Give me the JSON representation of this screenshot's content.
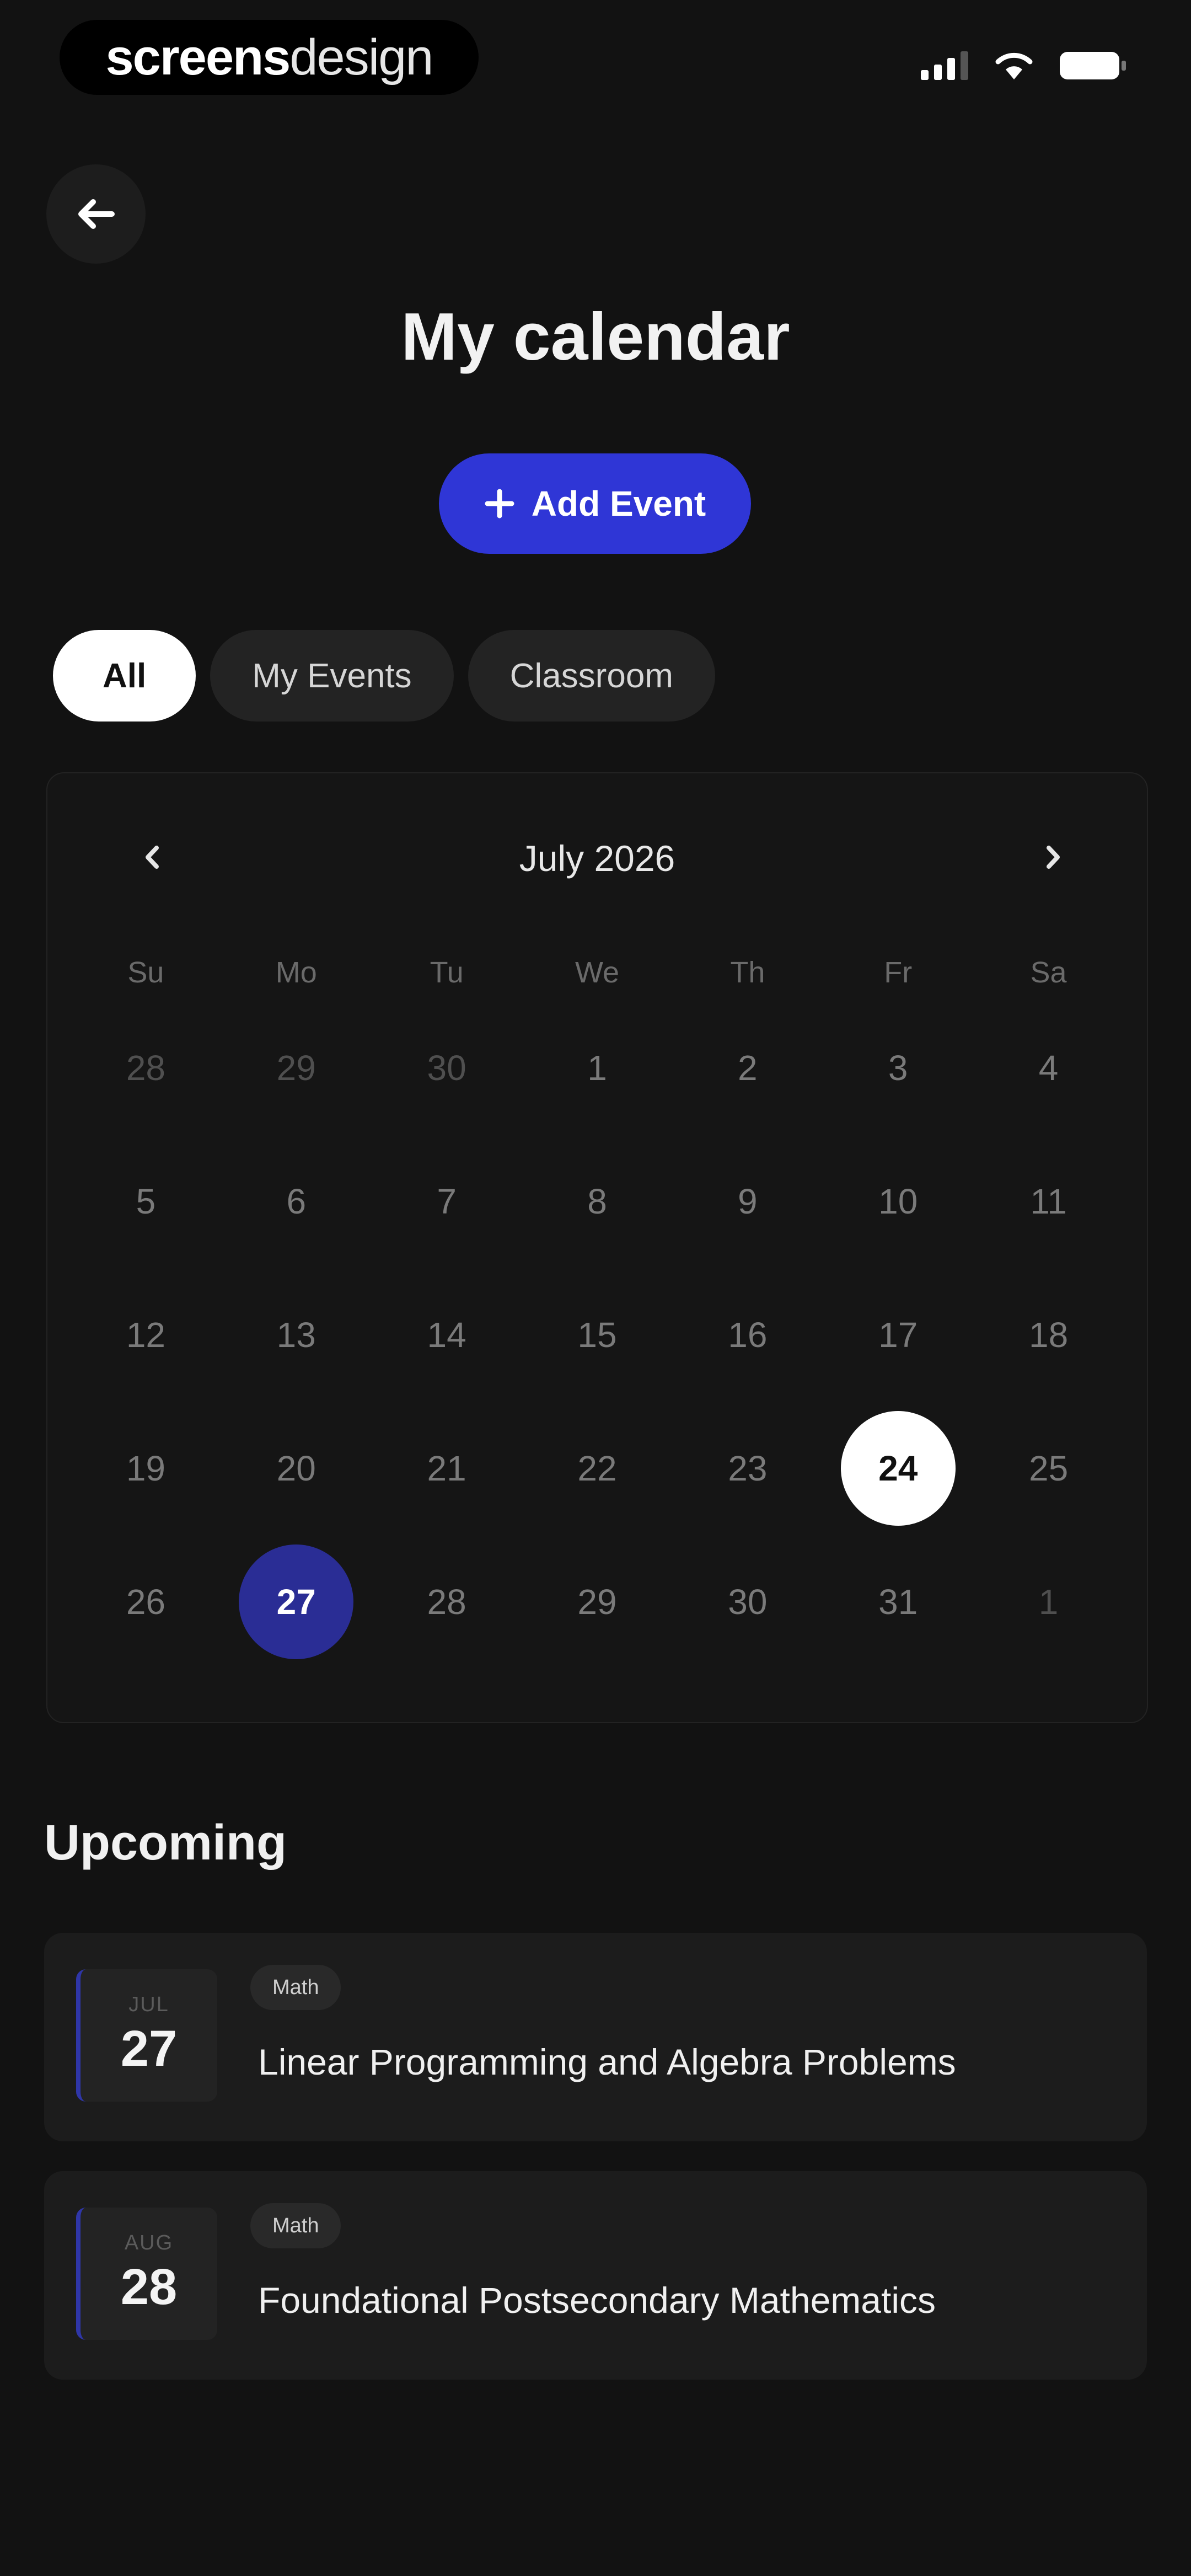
{
  "status_bar": {
    "brand_bold": "screens",
    "brand_light": "design"
  },
  "header": {
    "title": "My calendar",
    "add_button_label": "Add Event"
  },
  "filters": [
    {
      "label": "All",
      "active": true
    },
    {
      "label": "My Events",
      "active": false
    },
    {
      "label": "Classroom",
      "active": false
    }
  ],
  "calendar": {
    "month_label": "July 2026",
    "weekdays": [
      "Su",
      "Mo",
      "Tu",
      "We",
      "Th",
      "Fr",
      "Sa"
    ],
    "days": [
      {
        "n": "28",
        "muted": true
      },
      {
        "n": "29",
        "muted": true
      },
      {
        "n": "30",
        "muted": true
      },
      {
        "n": "1"
      },
      {
        "n": "2"
      },
      {
        "n": "3"
      },
      {
        "n": "4"
      },
      {
        "n": "5"
      },
      {
        "n": "6"
      },
      {
        "n": "7"
      },
      {
        "n": "8"
      },
      {
        "n": "9"
      },
      {
        "n": "10"
      },
      {
        "n": "11"
      },
      {
        "n": "12"
      },
      {
        "n": "13"
      },
      {
        "n": "14"
      },
      {
        "n": "15"
      },
      {
        "n": "16"
      },
      {
        "n": "17"
      },
      {
        "n": "18"
      },
      {
        "n": "19"
      },
      {
        "n": "20"
      },
      {
        "n": "21"
      },
      {
        "n": "22"
      },
      {
        "n": "23"
      },
      {
        "n": "24",
        "state": "today"
      },
      {
        "n": "25"
      },
      {
        "n": "26"
      },
      {
        "n": "27",
        "state": "selected"
      },
      {
        "n": "28"
      },
      {
        "n": "29"
      },
      {
        "n": "30"
      },
      {
        "n": "31"
      },
      {
        "n": "1",
        "muted": true
      }
    ]
  },
  "upcoming": {
    "title": "Upcoming",
    "events": [
      {
        "month": "JUL",
        "day": "27",
        "tag": "Math",
        "title": "Linear Programming and Algebra Problems"
      },
      {
        "month": "AUG",
        "day": "28",
        "tag": "Math",
        "title": "Foundational Postsecondary Mathematics"
      }
    ]
  },
  "colors": {
    "accent": "#2f36d6",
    "selected_day": "#2a2d95",
    "background": "#121212"
  }
}
